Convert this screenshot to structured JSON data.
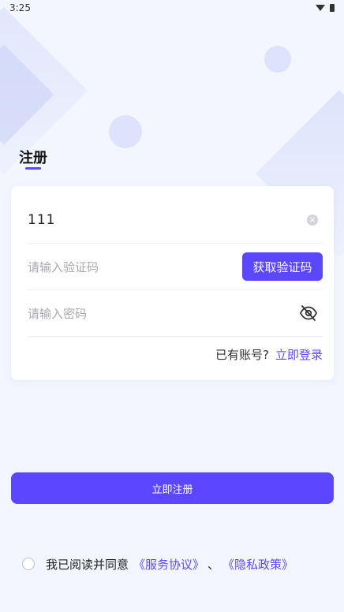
{
  "status_bar": {
    "time": "3:25"
  },
  "page": {
    "title": "注册"
  },
  "form": {
    "phone_value": "111",
    "code_placeholder": "请输入验证码",
    "get_code_label": "获取验证码",
    "password_placeholder": "请输入密码",
    "have_account_text": "已有账号?",
    "login_link_text": "立即登录"
  },
  "register_button_label": "立即注册",
  "agreement": {
    "prefix": "我已阅读并同意",
    "service_link": "《服务协议》",
    "separator": "、",
    "privacy_link": "《隐私政策》"
  },
  "icons": {
    "clear": "clear-icon",
    "eye_off": "eye-off-icon",
    "wifi": "wifi-icon",
    "battery": "battery-icon"
  },
  "colors": {
    "accent": "#5b47ff",
    "background": "#f4f6fe",
    "card": "#ffffff"
  }
}
